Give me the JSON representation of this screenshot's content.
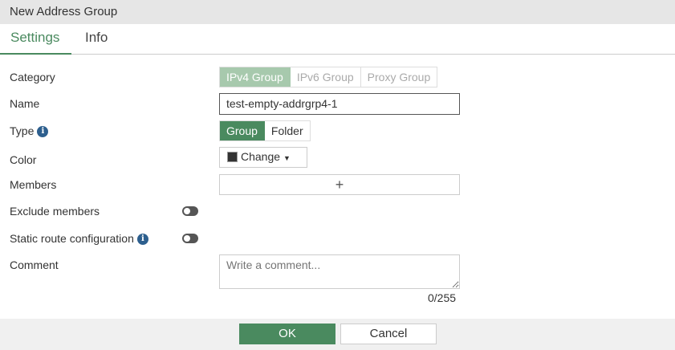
{
  "title": "New Address Group",
  "tabs": {
    "settings": "Settings",
    "info": "Info"
  },
  "labels": {
    "category": "Category",
    "name": "Name",
    "type": "Type",
    "color": "Color",
    "members": "Members",
    "exclude": "Exclude members",
    "static_route": "Static route configuration",
    "comment": "Comment"
  },
  "category": {
    "options": [
      "IPv4 Group",
      "IPv6 Group",
      "Proxy Group"
    ],
    "selected": "IPv4 Group"
  },
  "name_value": "test-empty-addrgrp4-1",
  "type": {
    "options": [
      "Group",
      "Folder"
    ],
    "selected": "Group"
  },
  "color": {
    "button": "Change"
  },
  "members": {
    "add": "+"
  },
  "toggles": {
    "exclude": false,
    "static_route": false
  },
  "comment": {
    "placeholder": "Write a comment...",
    "counter": "0/255"
  },
  "footer": {
    "ok": "OK",
    "cancel": "Cancel"
  },
  "colors": {
    "accent": "#4a8a5f",
    "accent_light": "#a7c9ad",
    "info": "#2d5f8e"
  }
}
